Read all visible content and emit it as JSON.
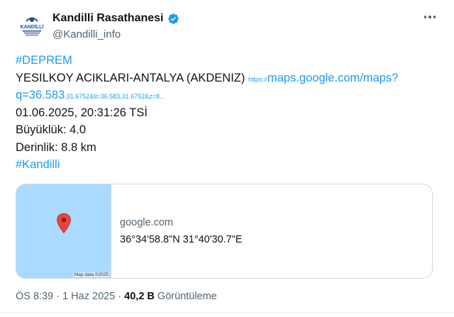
{
  "author": {
    "display_name": "Kandilli Rasathanesi",
    "handle": "@Kandilli_info",
    "verified": true,
    "avatar_text": "KANDİLLİ"
  },
  "tweet": {
    "hashtag1": "#DEPREM",
    "location_line": "YESILKOY ACIKLARI-ANTALYA (AKDENIZ)",
    "link_scheme": "https://",
    "link_host": "maps.google.com/maps?",
    "link_q": "q=36.583",
    "link_rest": ",31.6752&ll=36.583,31.6752&z=8...",
    "datetime": "01.06.2025, 20:31:26 TSİ",
    "magnitude": "Büyüklük: 4.0",
    "depth": "Derinlik: 8.8 km",
    "hashtag2": "#Kandilli"
  },
  "card": {
    "domain": "google.com",
    "title": "36°34'58.8\"N 31°40'30.7\"E",
    "map_attribution": "Map data ©2025"
  },
  "meta": {
    "time": "ÖS 8:39",
    "separator": " · ",
    "date": "1 Haz 2025",
    "views_value": "40,2 B",
    "views_label": "Görüntüleme"
  },
  "colors": {
    "accent": "#1d9bf0",
    "map_water": "#aadaff",
    "pin": "#e8453c"
  },
  "icons": {
    "verified": "verified-badge-icon",
    "more": "more-options-icon",
    "pin": "map-pin-icon"
  }
}
